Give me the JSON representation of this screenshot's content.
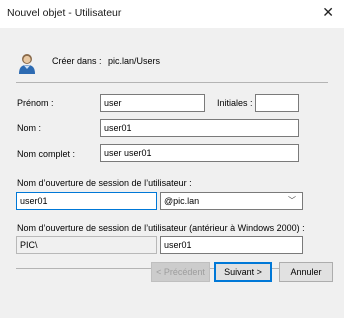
{
  "window": {
    "title": "Nouvel objet - Utilisateur",
    "close_glyph": "✕"
  },
  "header": {
    "create_in_label": "Créer dans :",
    "create_in_path": "pic.lan/Users",
    "icon": "user-icon"
  },
  "form": {
    "first_name_label": "Prénom :",
    "first_name_value": "user",
    "initials_label": "Initiales :",
    "initials_value": "",
    "last_name_label": "Nom :",
    "last_name_value": "user01",
    "full_name_label": "Nom complet :",
    "full_name_value": "user user01",
    "logon_name_label": "Nom d’ouverture de session de l’utilisateur :",
    "logon_name_value": "user01",
    "domain_suffix_value": "@pic.lan",
    "legacy_logon_label": "Nom d’ouverture de session de l’utilisateur (antérieur à Windows 2000) :",
    "legacy_domain_value": "PIC\\",
    "legacy_logon_value": "user01"
  },
  "buttons": {
    "previous": "< Précédent",
    "next": "Suivant >",
    "cancel": "Annuler"
  },
  "colors": {
    "accent": "#0078d7",
    "dialog_bg": "#f0f0f0"
  }
}
